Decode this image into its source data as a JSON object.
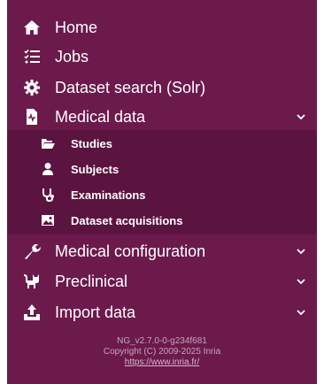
{
  "menu": {
    "items": [
      {
        "label": "Home",
        "icon": "home-icon"
      },
      {
        "label": "Jobs",
        "icon": "tasks-icon"
      },
      {
        "label": "Dataset search (Solr)",
        "icon": "gear-icon"
      },
      {
        "label": "Medical data",
        "icon": "file-medical-icon",
        "expanded": true
      },
      {
        "label": "Medical configuration",
        "icon": "wrench-icon"
      },
      {
        "label": "Preclinical",
        "icon": "cat-icon"
      },
      {
        "label": "Import data",
        "icon": "upload-icon"
      }
    ],
    "medical_data_children": [
      {
        "label": "Studies",
        "icon": "folder-open-icon"
      },
      {
        "label": "Subjects",
        "icon": "user-icon"
      },
      {
        "label": "Examinations",
        "icon": "stethoscope-icon"
      },
      {
        "label": "Dataset acquisitions",
        "icon": "image-icon"
      }
    ]
  },
  "footer": {
    "version": "NG_v2.7.0-0-g234f681",
    "copyright": "Copyright (C) 2009-2025 Inria",
    "link": "https://www.inria.fr/"
  },
  "colors": {
    "sidebar": "#6b1a4b",
    "submenu": "#5b1340",
    "text": "#ffffff",
    "footer_text": "#c7a6bc"
  }
}
